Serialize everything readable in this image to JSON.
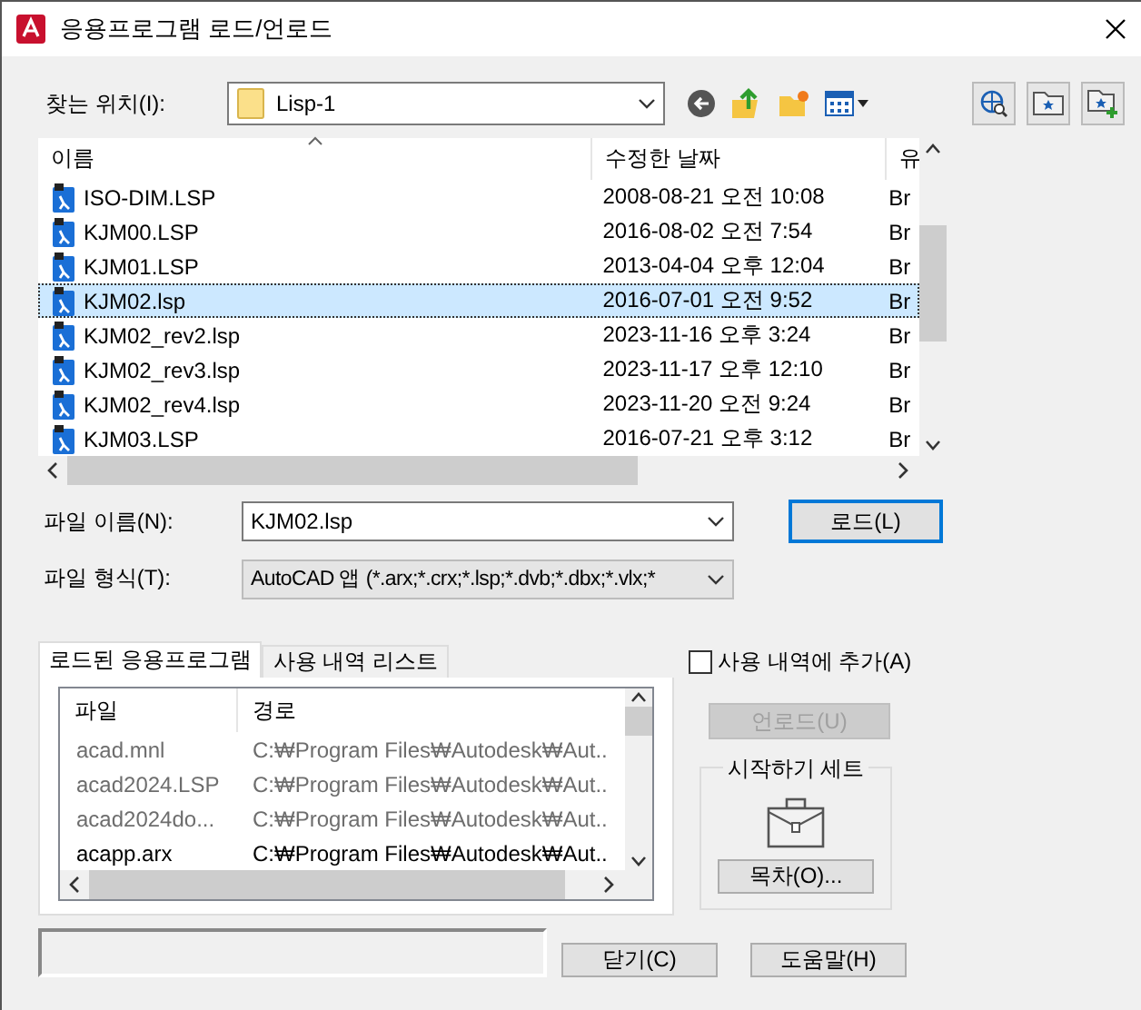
{
  "window": {
    "title": "응용프로그램 로드/언로드"
  },
  "location": {
    "label": "찾는 위치(I):",
    "value": "Lisp-1"
  },
  "file_list": {
    "columns": [
      "이름",
      "수정한 날짜",
      "유"
    ],
    "rows": [
      {
        "name": "ISO-DIM.LSP",
        "date": "2008-08-21 오전 10:08",
        "column_3": "Br",
        "selected": false
      },
      {
        "name": "KJM00.LSP",
        "date": "2016-08-02 오전 7:54",
        "column_3": "Br",
        "selected": false
      },
      {
        "name": "KJM01.LSP",
        "date": "2013-04-04 오후 12:04",
        "column_3": "Br",
        "selected": false
      },
      {
        "name": "KJM02.lsp",
        "date": "2016-07-01 오전 9:52",
        "column_3": "Br",
        "selected": true
      },
      {
        "name": "KJM02_rev2.lsp",
        "date": "2023-11-16 오후 3:24",
        "column_3": "Br",
        "selected": false
      },
      {
        "name": "KJM02_rev3.lsp",
        "date": "2023-11-17 오후 12:10",
        "column_3": "Br",
        "selected": false
      },
      {
        "name": "KJM02_rev4.lsp",
        "date": "2023-11-20 오전 9:24",
        "column_3": "Br",
        "selected": false
      },
      {
        "name": "KJM03.LSP",
        "date": "2016-07-21 오후 3:12",
        "column_3": "Br",
        "selected": false
      }
    ]
  },
  "file_name": {
    "label": "파일 이름(N):",
    "value": "KJM02.lsp"
  },
  "file_type": {
    "label": "파일 형식(T):",
    "value": "AutoCAD 앱 (*.arx;*.crx;*.lsp;*.dvb;*.dbx;*.vlx;*"
  },
  "load_button": {
    "label": "로드(L)"
  },
  "tabs": [
    {
      "label": "로드된 응용프로그램",
      "selected": true
    },
    {
      "label": "사용 내역 리스트",
      "selected": false
    }
  ],
  "loaded": {
    "columns": [
      "파일",
      "경로"
    ],
    "rows": [
      {
        "file": "acad.mnl",
        "path": "C:₩Program Files₩Autodesk₩Aut..",
        "disabled": true
      },
      {
        "file": "acad2024.LSP",
        "path": "C:₩Program Files₩Autodesk₩Aut..",
        "disabled": true
      },
      {
        "file": "acad2024do...",
        "path": "C:₩Program Files₩Autodesk₩Aut..",
        "disabled": true
      },
      {
        "file": "acapp.arx",
        "path": "C:₩Program Files₩Autodesk₩Aut..",
        "disabled": false
      }
    ]
  },
  "add_to_history": {
    "label": "사용 내역에 추가(A)",
    "checked": false
  },
  "unload_button": {
    "label": "언로드(U)",
    "disabled": true
  },
  "startup_suite": {
    "title": "시작하기 세트",
    "button": "목차(O)..."
  },
  "buttons": [
    {
      "label": "닫기(C)"
    },
    {
      "label": "도움말(H)"
    }
  ]
}
